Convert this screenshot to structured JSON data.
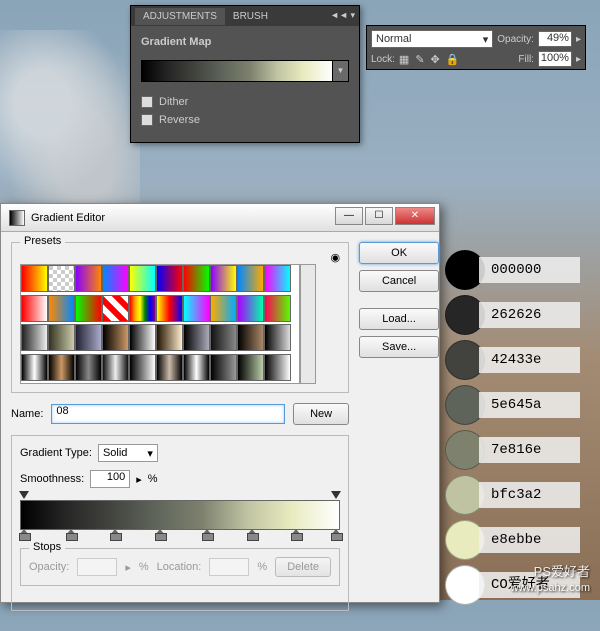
{
  "adjustments": {
    "tab1": "ADJUSTMENTS",
    "tab2": "BRUSH",
    "title": "Gradient Map",
    "dither": "Dither",
    "reverse": "Reverse"
  },
  "layers": {
    "blend": "Normal",
    "opacity_label": "Opacity:",
    "opacity_value": "49%",
    "lock_label": "Lock:",
    "fill_label": "Fill:",
    "fill_value": "100%"
  },
  "editor": {
    "title": "Gradient Editor",
    "presets_label": "Presets",
    "ok": "OK",
    "cancel": "Cancel",
    "load": "Load...",
    "save": "Save...",
    "new": "New",
    "name_label": "Name:",
    "name_value": "08",
    "gtype_label": "Gradient Type:",
    "gtype_value": "Solid",
    "smooth_label": "Smoothness:",
    "smooth_value": "100",
    "percent": "%",
    "stops_label": "Stops",
    "opacity_label": "Opacity:",
    "location_label": "Location:",
    "delete": "Delete"
  },
  "swatches": [
    {
      "color": "#000000",
      "label": "000000"
    },
    {
      "color": "#262626",
      "label": "262626"
    },
    {
      "color": "#42433e",
      "label": "42433e"
    },
    {
      "color": "#5e645a",
      "label": "5e645a"
    },
    {
      "color": "#7e816e",
      "label": "7e816e"
    },
    {
      "color": "#bfc3a2",
      "label": "bfc3a2"
    },
    {
      "color": "#e8ebbe",
      "label": "e8ebbe"
    },
    {
      "color": "#ffffff",
      "label": "CO爱好者"
    }
  ],
  "presets": [
    "linear-gradient(90deg,#f00,#ff0)",
    "repeating-conic-gradient(#fff 0 25%,#ccc 0 50%) 0 0/8px 8px",
    "linear-gradient(90deg,#80f,#f80)",
    "linear-gradient(90deg,#08f,#f0f)",
    "linear-gradient(90deg,#ff0,#0ff)",
    "linear-gradient(90deg,#00f,#f00)",
    "linear-gradient(90deg,#f00,#0f0)",
    "linear-gradient(90deg,#80f,#ff0)",
    "linear-gradient(90deg,#08f,#fa0)",
    "linear-gradient(90deg,#f0f,#0ff)",
    "linear-gradient(90deg,#f00,#fff)",
    "linear-gradient(90deg,#f80,#08f)",
    "linear-gradient(90deg,#0f0,#f00)",
    "repeating-linear-gradient(45deg,#f00 0 6px,#fff 6px 12px)",
    "linear-gradient(90deg,red,orange,yellow,green,blue,purple)",
    "linear-gradient(90deg,#ff0,#f00,#00f)",
    "linear-gradient(90deg,#0ff,#f0f)",
    "linear-gradient(90deg,#fa0,#0af)",
    "linear-gradient(90deg,#a0f,#0fa)",
    "linear-gradient(90deg,#f05,#5f0)",
    "linear-gradient(90deg,#222,#eee)",
    "linear-gradient(90deg,#332,#cca)",
    "linear-gradient(90deg,#223,#aac)",
    "linear-gradient(90deg,#000,#c96)",
    "linear-gradient(90deg,#000,#fff)",
    "linear-gradient(90deg,#210,#fec)",
    "linear-gradient(90deg,#000,#aab)",
    "linear-gradient(90deg,#111,#888)",
    "linear-gradient(90deg,#000,#a86)",
    "linear-gradient(90deg,#000,#ddd)",
    "linear-gradient(90deg,#000,#fff,#000)",
    "linear-gradient(90deg,#000,#c96,#000)",
    "linear-gradient(90deg,#000,#888,#000)",
    "linear-gradient(90deg,#111,#eee,#111)",
    "linear-gradient(90deg,#000,#fff)",
    "linear-gradient(90deg,#000,#cba,#000)",
    "linear-gradient(90deg,#000,#fff,#000)",
    "linear-gradient(90deg,#000,#999)",
    "linear-gradient(90deg,#000,#bca)",
    "linear-gradient(90deg,#000,#fff)"
  ],
  "watermark1": "PS爱好者",
  "watermark2": "www.psahz.com"
}
